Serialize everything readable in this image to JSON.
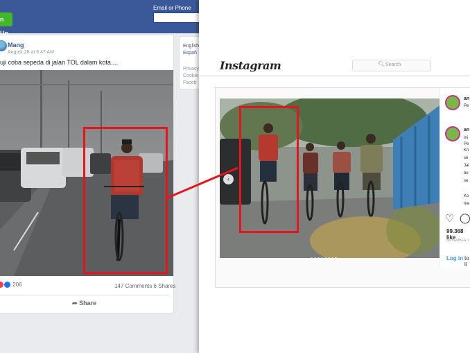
{
  "facebook": {
    "signup_label": "n Up",
    "email_label": "Email or Phone",
    "post": {
      "author": "Mang",
      "date": "August 28 at 6:47 AM",
      "text": "uji coba sepeda di jalan TOL dalam kota....",
      "reaction_count": "206",
      "comments": "147 Comments",
      "shares": "6 Shares",
      "share_label": "Share"
    },
    "sidebar": {
      "lang_en": "English",
      "lang_es": "Españ",
      "privacy": "Privacy",
      "cookies": "Cookie",
      "facebook": "Faceb"
    },
    "colors": {
      "topbar": "#3b5998",
      "signup": "#42b72a",
      "link": "#385898"
    }
  },
  "instagram": {
    "logo": "Instagram",
    "search_placeholder": "Search",
    "search_icon": "magnifier-icon",
    "user1": "an",
    "location": "Pe",
    "user2": "an",
    "caption_lines": [
      "ini",
      "Pe",
      "Kri",
      "se",
      "Jal",
      "be",
      "se"
    ],
    "caption_more": [
      "Ko",
      "me"
    ],
    "likes": "99.368 like",
    "date": "NOVEMBER 1",
    "login_link": "Log in",
    "login_rest": "to li",
    "carousel_dots": 8,
    "carousel_active": 7
  },
  "overlay": {
    "color": "#e4161b"
  }
}
